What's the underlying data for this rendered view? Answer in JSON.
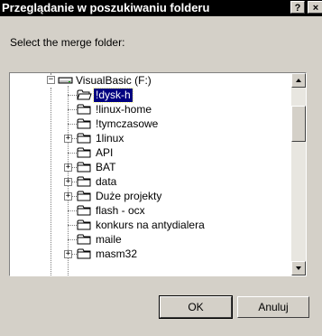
{
  "window": {
    "title": "Przeglądanie w poszukiwaniu folderu",
    "help_label": "?",
    "close_label": "×"
  },
  "prompt": "Select the merge folder:",
  "tree": {
    "root": {
      "label": "VisualBasic (F:)",
      "expander": "−",
      "icon": "drive-icon"
    },
    "items": [
      {
        "label": "!dysk-h",
        "expander": "",
        "selected": true,
        "icon": "folder-open-icon"
      },
      {
        "label": "!linux-home",
        "expander": "",
        "icon": "folder-icon"
      },
      {
        "label": "!tymczasowe",
        "expander": "",
        "icon": "folder-icon"
      },
      {
        "label": "1linux",
        "expander": "+",
        "icon": "folder-icon"
      },
      {
        "label": "API",
        "expander": "",
        "icon": "folder-icon"
      },
      {
        "label": "BAT",
        "expander": "+",
        "icon": "folder-icon"
      },
      {
        "label": "data",
        "expander": "+",
        "icon": "folder-icon"
      },
      {
        "label": "Duże projekty",
        "expander": "+",
        "icon": "folder-icon"
      },
      {
        "label": "flash - ocx",
        "expander": "",
        "icon": "folder-icon"
      },
      {
        "label": "konkurs na antydialera",
        "expander": "",
        "icon": "folder-icon"
      },
      {
        "label": "maile",
        "expander": "",
        "icon": "folder-icon"
      },
      {
        "label": "masm32",
        "expander": "+",
        "icon": "folder-icon"
      }
    ]
  },
  "buttons": {
    "ok": "OK",
    "cancel": "Anuluj"
  },
  "colors": {
    "dialog": "#d4d0c8",
    "titlebar": "#000000",
    "selection": "#000080"
  }
}
